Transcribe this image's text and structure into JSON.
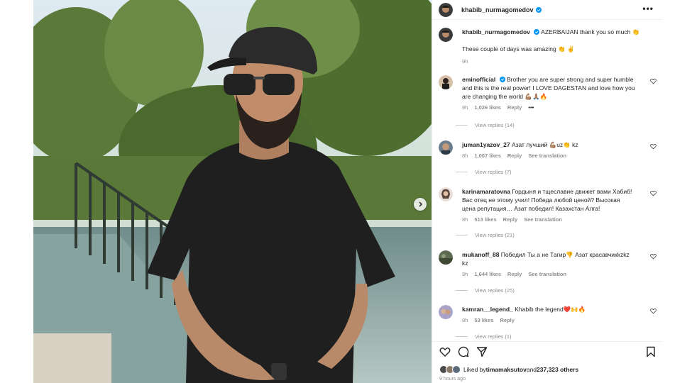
{
  "post": {
    "author": "khabib_nurmagomedov",
    "more_label": "•••"
  },
  "caption": {
    "username": "khabib_nurmagomedov",
    "line1": " AZERBAIJAN thank you so much 👏",
    "line2": "These couple of days was amazing 👏 ✌️",
    "time": "9h"
  },
  "comments": [
    {
      "username": "eminofficial",
      "text_l1": " Brother you are super strong and super humble",
      "text_l2": "and this is the real power! I LOVE DAGESTAN and love how you",
      "text_l3": "are changing the world 💪🏽🙏🏽🔥",
      "time": "9h",
      "likes": "1,026 likes",
      "reply": "Reply",
      "extra": "•••",
      "view_replies": "View replies (14)"
    },
    {
      "username": "juman1yazov_27",
      "text_l1": " Азат лучший 💪🏽uz👏 kz",
      "time": "8h",
      "likes": "1,007 likes",
      "reply": "Reply",
      "translate": "See translation",
      "view_replies": "View replies (7)"
    },
    {
      "username": "karinamaratovna",
      "text_l1": " Гордыня и тщеславие движет вами Хабиб!",
      "text_l2": "Вас отец не этому учил! Победа любой ценой? Высокая",
      "text_l3": "цена репутация… Азат победил! Казахстан Алга!",
      "time": "8h",
      "likes": "513 likes",
      "reply": "Reply",
      "translate": "See translation",
      "view_replies": "View replies (21)"
    },
    {
      "username": "mukanoff_88",
      "text_l1": " Победил Ты а не Тагир👎 Азат красавчикkzkz",
      "text_l2": "kz",
      "time": "9h",
      "likes": "1,644 likes",
      "reply": "Reply",
      "translate": "See translation",
      "view_replies": "View replies (25)"
    },
    {
      "username": "kamran__legend_",
      "text_l1": " Khabib the legend❤️🙌🔥",
      "time": "8h",
      "likes": "53 likes",
      "reply": "Reply",
      "view_replies": "View replies (1)"
    }
  ],
  "footer": {
    "liked_by_prefix": "Liked by ",
    "liked_by_user": "timamaksutov",
    "liked_by_and": " and ",
    "liked_by_count": "237,323 others",
    "timestamp": "9 hours ago"
  },
  "icons": {
    "more": "more-options-icon",
    "verified": "verified-badge-icon",
    "like": "heart-icon",
    "comment": "comment-icon",
    "share": "share-icon",
    "save": "bookmark-icon",
    "next": "chevron-right-icon"
  },
  "colors": {
    "verified": "#0095f6",
    "text": "#262626",
    "muted": "#8e8e8e"
  }
}
